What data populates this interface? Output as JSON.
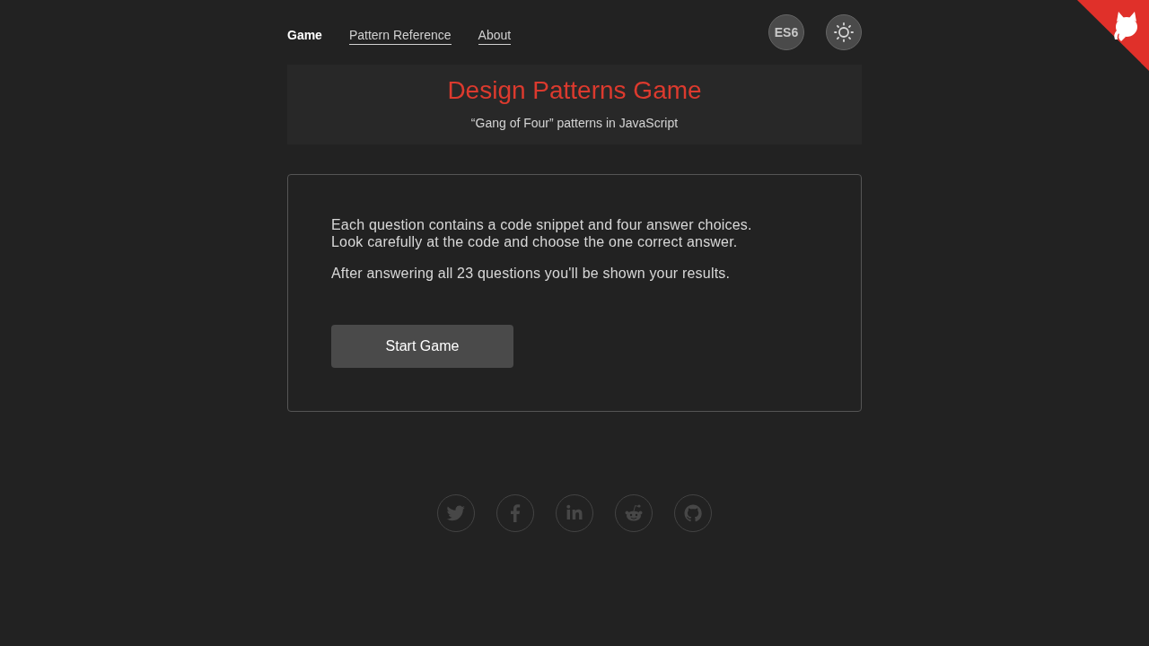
{
  "nav": {
    "links": [
      {
        "label": "Game",
        "selected": true
      },
      {
        "label": "Pattern Reference",
        "selected": false
      },
      {
        "label": "About",
        "selected": false
      }
    ],
    "es6_toggle": {
      "label": "ES6"
    }
  },
  "header": {
    "title": "Design Patterns Game",
    "subtitle": "“Gang of Four” patterns in JavaScript"
  },
  "intro": {
    "paragraphs": [
      "Each question contains a code snippet and four answer choices.\nLook carefully at the code and choose the one correct answer.",
      "After answering all 23 questions you'll be shown your results."
    ],
    "button": "Start Game"
  },
  "footer": {
    "social_links": [
      {
        "kind": "twitter"
      },
      {
        "kind": "facebook"
      },
      {
        "kind": "linkedin"
      },
      {
        "kind": "reddit"
      },
      {
        "kind": "github"
      }
    ]
  }
}
